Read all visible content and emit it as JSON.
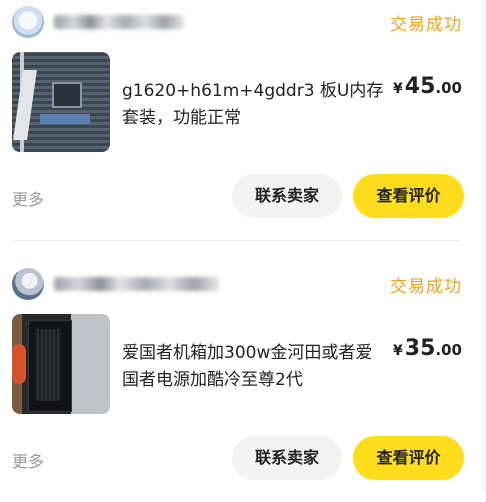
{
  "orders": [
    {
      "status": "交易成功",
      "seller_name": "",
      "title": "g1620+h61m+4gddr3  板U内存套装，功能正常",
      "price_currency": "¥",
      "price_int": "45",
      "price_dec": ".00",
      "more_label": "更多",
      "contact_label": "联系卖家",
      "review_label": "查看评价"
    },
    {
      "status": "交易成功",
      "seller_name": "",
      "title": "爱国者机箱加300w金河田或者爱国者电源加酷冷至尊2代",
      "price_currency": "¥",
      "price_int": "35",
      "price_dec": ".00",
      "more_label": "更多",
      "contact_label": "联系卖家",
      "review_label": "查看评价"
    }
  ],
  "colors": {
    "status": "#f3a21b",
    "review_button": "#ffdd1c",
    "contact_button": "#f3f3f4",
    "muted_text": "#999999"
  },
  "icons": {
    "avatar_1": "user-avatar",
    "avatar_2": "user-avatar",
    "thumb_1": "motherboard-photo",
    "thumb_2": "pc-case-photo"
  }
}
